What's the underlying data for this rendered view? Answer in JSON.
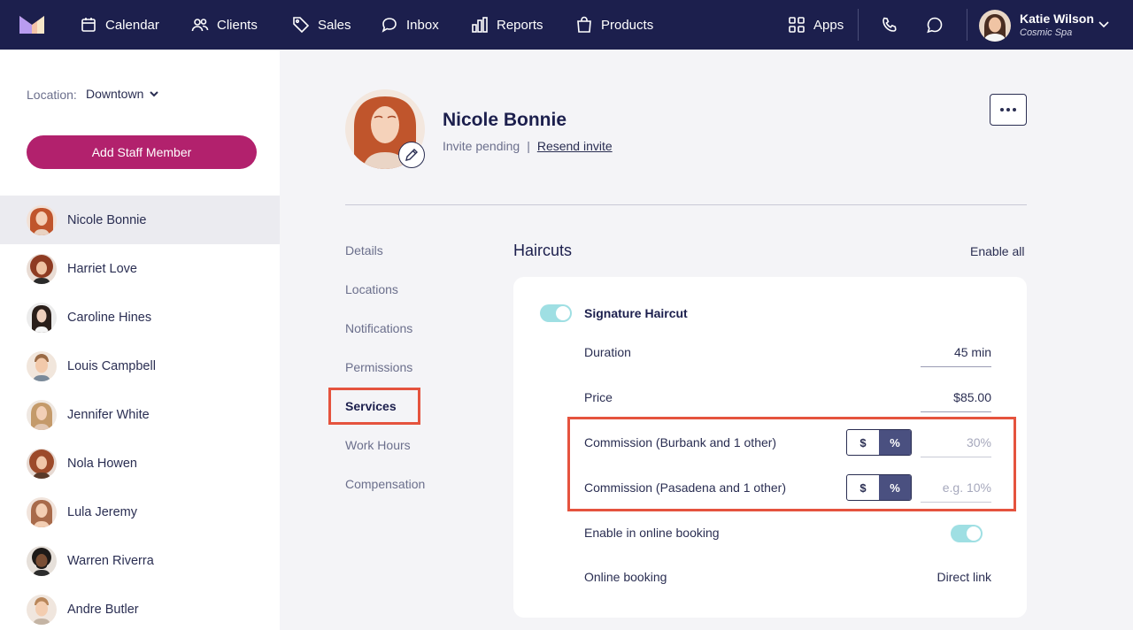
{
  "nav": {
    "items": [
      {
        "label": "Calendar",
        "icon": "calendar-icon"
      },
      {
        "label": "Clients",
        "icon": "users-icon"
      },
      {
        "label": "Sales",
        "icon": "tag-icon"
      },
      {
        "label": "Inbox",
        "icon": "chat-icon"
      },
      {
        "label": "Reports",
        "icon": "bar-chart-icon"
      },
      {
        "label": "Products",
        "icon": "shopping-bag-icon"
      }
    ],
    "apps_label": "Apps",
    "user_name": "Katie Wilson",
    "user_business": "Cosmic Spa"
  },
  "sidebar": {
    "location_label": "Location:",
    "location_value": "Downtown",
    "add_button": "Add Staff Member",
    "staff": [
      "Nicole Bonnie",
      "Harriet Love",
      "Caroline Hines",
      "Louis Campbell",
      "Jennifer White",
      "Nola Howen",
      "Lula Jeremy",
      "Warren Riverra",
      "Andre Butler"
    ]
  },
  "profile": {
    "name": "Nicole Bonnie",
    "status": "Invite pending",
    "separator": "|",
    "resend": "Resend invite"
  },
  "subnav": [
    "Details",
    "Locations",
    "Notifications",
    "Permissions",
    "Services",
    "Work Hours",
    "Compensation"
  ],
  "section": {
    "title": "Haircuts",
    "enable_all": "Enable all"
  },
  "service": {
    "title": "Signature Haircut",
    "duration_label": "Duration",
    "duration_value": "45 min",
    "price_label": "Price",
    "price_value": "$85.00",
    "commission1_label": "Commission (Burbank and 1 other)",
    "commission1_placeholder": "30%",
    "commission2_label": "Commission (Pasadena and 1 other)",
    "commission2_placeholder": "e.g. 10%",
    "seg_dollar": "$",
    "seg_percent": "%",
    "online_label": "Enable in online booking",
    "booking_label": "Online booking",
    "direct_link": "Direct link"
  },
  "colors": {
    "nav_bg": "#1c1f4d",
    "primary_button": "#b2216d",
    "toggle_on": "#9fdfe3",
    "highlight": "#e5533e"
  }
}
